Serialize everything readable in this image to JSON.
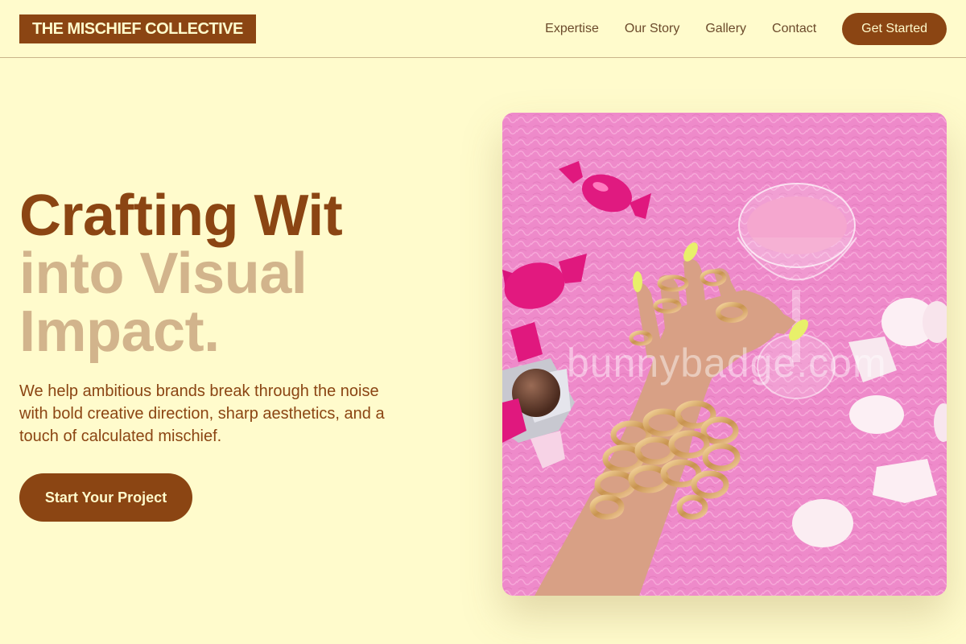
{
  "header": {
    "logo": "THE MISCHIEF COLLECTIVE",
    "nav": [
      "Expertise",
      "Our Story",
      "Gallery",
      "Contact"
    ],
    "cta": "Get Started"
  },
  "hero": {
    "title_line1": "Crafting Wit",
    "title_line2": "into Visual",
    "title_line3": "Impact.",
    "description": "We help ambitious brands break through the noise with bold creative direction, sharp aesthetics, and a touch of calculated mischief.",
    "button": "Start Your Project"
  },
  "image": {
    "watermark": "bunnybadge.com"
  },
  "colors": {
    "background": "#FFFBCC",
    "brand_brown": "#8B4513",
    "tan": "#D2B48C",
    "photo_pink": "#F08CCB"
  }
}
